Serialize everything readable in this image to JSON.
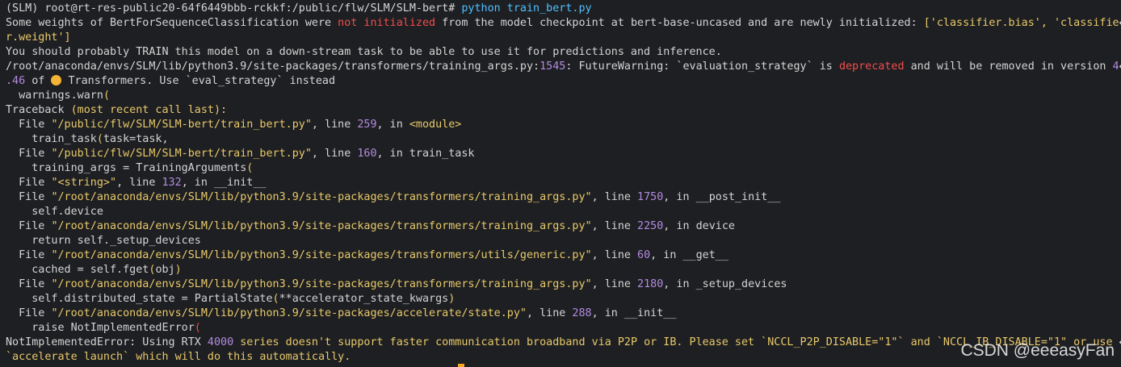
{
  "terminal": {
    "prompt": "(SLM) root@rt-res-public20-64f6449bbb-rckkf:/public/flw/SLM/SLM-bert#",
    "command": " python train_bert.py",
    "wrap_marker": "↩",
    "lines": {
      "l2a": "Some weights of BertForSequenceClassification were ",
      "l2b": "not initialized",
      "l2c": " from the model checkpoint at bert-base-uncased and are newly initialized: ",
      "l2d": "['classifier.bias', 'classifie",
      "l3": "r.weight']",
      "l4": "You should probably TRAIN this model on a down-stream task to be able to use it for predictions and inference.",
      "l5a": "/root/anaconda/envs/SLM/lib/python3.9/site-packages/transformers/training_args.py:",
      "l5b": "1545",
      "l5c": ": FutureWarning: `evaluation_strategy` is ",
      "l5d": "deprecated",
      "l5e": " and will be removed in version ",
      "l5f": "4",
      "l6a": ".46",
      "l6b": " of ",
      "l6c": " Transformers. Use `eval_strategy` instead",
      "l7a": "  warnings.warn",
      "l7b": "(",
      "l8a": "Traceback ",
      "l8b": "(most recent call last):",
      "t1_pre": "  File ",
      "t1_path": "\"/public/flw/SLM/SLM-bert/train_bert.py\"",
      "t1_mid": ", line ",
      "t1_num": "259",
      "t1_post": ", in ",
      "t1_fn": "<module>",
      "t1_code_a": "    train_task",
      "t1_code_b": "(",
      "t1_code_c": "task=task,",
      "t2_path": "\"/public/flw/SLM/SLM-bert/train_bert.py\"",
      "t2_num": "160",
      "t2_fn": "train_task",
      "t2_code_a": "    training_args = TrainingArguments",
      "t2_code_b": "(",
      "t3_path": "\"<string>\"",
      "t3_num": "132",
      "t3_fn": "__init__",
      "t4_path": "\"/root/anaconda/envs/SLM/lib/python3.9/site-packages/transformers/training_args.py\"",
      "t4_num": "1750",
      "t4_fn": "__post_init__",
      "t4_code": "    self.device",
      "t5_path": "\"/root/anaconda/envs/SLM/lib/python3.9/site-packages/transformers/training_args.py\"",
      "t5_num": "2250",
      "t5_fn": "device",
      "t5_code": "    return self._setup_devices",
      "t6_path": "\"/root/anaconda/envs/SLM/lib/python3.9/site-packages/transformers/utils/generic.py\"",
      "t6_num": "60",
      "t6_fn": "__get__",
      "t6_code_a": "    cached = self.fget",
      "t6_code_b": "(",
      "t6_code_c": "obj",
      "t6_code_d": ")",
      "t7_path": "\"/root/anaconda/envs/SLM/lib/python3.9/site-packages/transformers/training_args.py\"",
      "t7_num": "2180",
      "t7_fn": "_setup_devices",
      "t7_code_a": "    self.distributed_state = PartialState",
      "t7_code_b": "(",
      "t7_code_c": "**accelerator_state_kwargs",
      "t7_code_d": ")",
      "t8_path": "\"/root/anaconda/envs/SLM/lib/python3.9/site-packages/accelerate/state.py\"",
      "t8_num": "288",
      "t8_fn": "__init__",
      "t8_code_a": "    raise NotImplementedError",
      "t8_code_b": "(",
      "err_a": "NotImplementedError: Using RTX ",
      "err_b": "4000",
      "err_c": " series doesn't support faster communication broadband via P2P or IB. Please set `NCCL_P2P_DISABLE=\"1\"` and `NCCL_IB_DISABLE=\"1\" or use ",
      "err_d": "`accelerate launch`",
      "err_e": " which will do this automatically."
    }
  },
  "watermark": "CSDN @eeeasyFan",
  "colors": {
    "background": "#1e1f22",
    "text": "#d4d4d4",
    "string": "#e8c96a",
    "error": "#f14c4c",
    "number": "#b38be0",
    "command": "#4fc1ff",
    "cursor": "#f5a623"
  },
  "icons": {
    "emoji": "hugging-face-emoji-icon"
  }
}
